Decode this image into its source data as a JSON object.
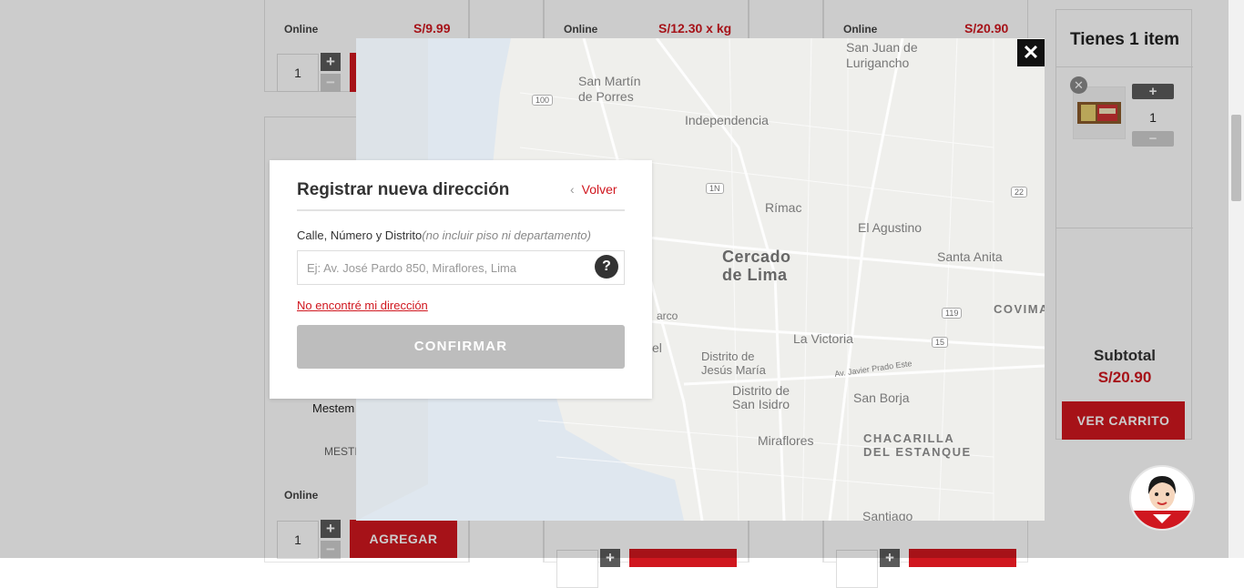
{
  "products": {
    "row1": [
      {
        "availability": "Online",
        "price": "S/9.99",
        "qty": "1"
      },
      {
        "availability": "Online",
        "price": "S/12.30 x kg"
      },
      {
        "availability": "Online",
        "price": "S/20.90"
      }
    ],
    "row2": {
      "name": "Mestem",
      "brand": "MESTI",
      "availability": "Online",
      "qty": "1",
      "add_label": "AGREGAR"
    },
    "stepper": {
      "plus": "+",
      "minus": "−"
    }
  },
  "cart": {
    "title": "Tienes 1 item",
    "item_qty": "1",
    "remove_glyph": "✕",
    "plus": "+",
    "minus": "−",
    "subtotal_label": "Subtotal",
    "subtotal_value": "S/20.90",
    "view_cart_label": "VER CARRITO"
  },
  "map": {
    "close_glyph": "✕",
    "labels": {
      "sjl": "San Juan de\nLurigancho",
      "smp": "San Martín\nde Porres",
      "independencia": "Independencia",
      "rimac": "Rímac",
      "el_agustino": "El Agustino",
      "cercado": "Cercado\nde Lima",
      "santa_anita": "Santa Anita",
      "la_victoria": "La Victoria",
      "jesus_maria": "Distrito de\nJesús María",
      "san_isidro": "Distrito de\nSan Isidro",
      "san_borja": "San Borja",
      "miraflores": "Miraflores",
      "chacarilla": "CHACARILLA\nDEL ESTANQUE",
      "santiago": "Santiago",
      "covima": "COVIMA",
      "javier_prado": "Av. Javier Prado Este",
      "parque": "arco",
      "el": "el"
    },
    "shields": [
      "100",
      "1N",
      "22",
      "119",
      "15"
    ]
  },
  "dialog": {
    "title": "Registrar nueva dirección",
    "back_label": "Volver",
    "back_glyph": "‹",
    "field_label": "Calle, Número y Distrito",
    "field_hint": "(no incluir piso ni departamento)",
    "field_placeholder": "Ej: Av. José Pardo 850, Miraflores, Lima",
    "help_glyph": "?",
    "not_found_label": "No encontré mi dirección",
    "confirm_label": "CONFIRMAR"
  },
  "colors": {
    "brand": "#d0171f",
    "disabled": "#bdbdbd"
  }
}
